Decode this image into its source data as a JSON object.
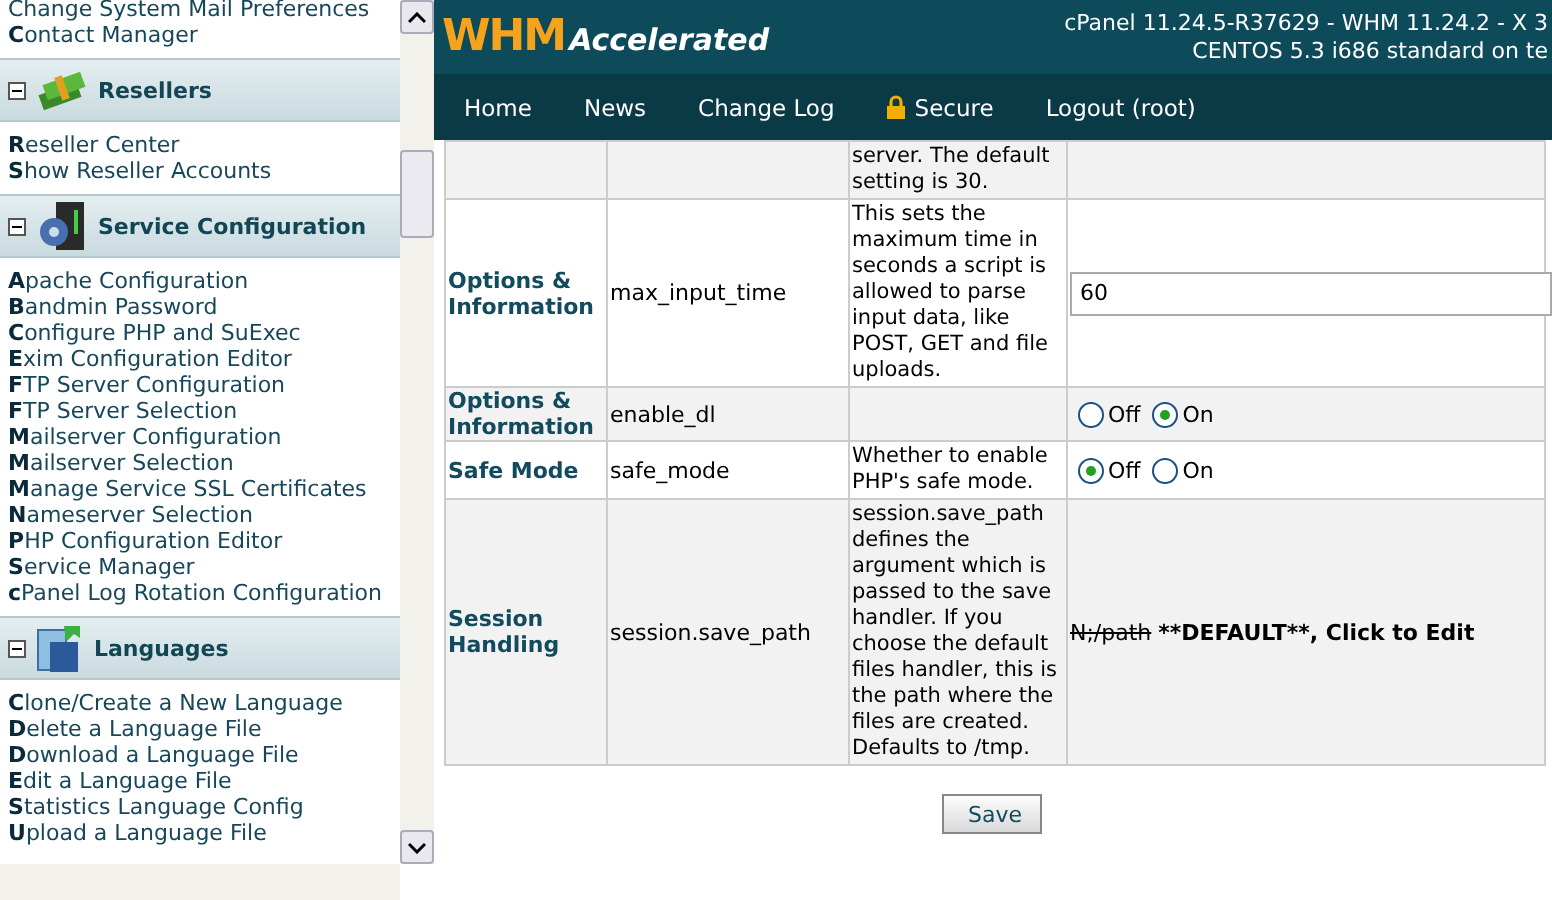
{
  "sidebar": {
    "sections": [
      {
        "items": [
          "Change System Mail Preferences",
          "**C**ontact Manager"
        ]
      },
      {
        "title": "Resellers",
        "expanded": true,
        "items": [
          "**R**eseller Center",
          "**S**how Reseller Accounts"
        ]
      },
      {
        "title": "Service Configuration",
        "expanded": true,
        "items": [
          "**A**pache Configuration",
          "**B**andmin Password",
          "**C**onfigure PHP and SuExec",
          "**E**xim Configuration Editor",
          "**F**TP Server Configuration",
          "**F**TP Server Selection",
          "**M**ailserver Configuration",
          "**M**ailserver Selection",
          "**M**anage Service SSL Certificates",
          "**N**ameserver Selection",
          "**P**HP Configuration Editor",
          "**S**ervice Manager",
          "**c**Panel Log Rotation Configuration"
        ]
      },
      {
        "title": "Languages",
        "expanded": true,
        "items": [
          "**C**lone/Create a New Language",
          "**D**elete a Language File",
          "**D**ownload a Language File",
          "**E**dit a Language File",
          "**S**tatistics Language Config",
          "**U**pload a Language File"
        ]
      }
    ]
  },
  "header": {
    "logo_main": "WHM",
    "logo_sub": "Accelerated",
    "version_line": "cPanel 11.24.5-R37629 - WHM 11.24.2 - X 3",
    "os_line": "CENTOS 5.3 i686 standard on te"
  },
  "nav": [
    {
      "label": "Home",
      "kind": "link"
    },
    {
      "label": "News",
      "kind": "link"
    },
    {
      "label": "Change Log",
      "kind": "link"
    },
    {
      "label": "Secure",
      "kind": "locked"
    },
    {
      "label": "Logout (root)",
      "kind": "link"
    }
  ],
  "table": {
    "rows": [
      {
        "description": "server. The default setting is 30."
      },
      {
        "category": "Options & Information",
        "directive": "max_input_time",
        "description": "This sets the maximum time in seconds a script is allowed to parse input data, like POST, GET and file uploads.",
        "value": {
          "kind": "text",
          "value": "60"
        }
      },
      {
        "category": "Options & Information",
        "directive": "enable_dl",
        "value": {
          "kind": "radio",
          "options": [
            {
              "label": "Off",
              "selected": false
            },
            {
              "label": "On",
              "selected": true
            }
          ]
        }
      },
      {
        "category": "Safe Mode",
        "directive": "safe_mode",
        "description": "Whether to enable PHP's safe mode.",
        "value": {
          "kind": "radio",
          "options": [
            {
              "label": "Off",
              "selected": true
            },
            {
              "label": "On",
              "selected": false
            }
          ]
        }
      },
      {
        "category": "Session Handling",
        "directive": "session.save_path",
        "description": "session.save_path defines the argument which is passed to the save handler. If you choose the default files handler, this is the path where the files are created. Defaults to /tmp.",
        "value": {
          "kind": "edit",
          "struck": "N;/path",
          "label": "**DEFAULT**, Click to Edit"
        }
      }
    ]
  },
  "save_label": "Save"
}
